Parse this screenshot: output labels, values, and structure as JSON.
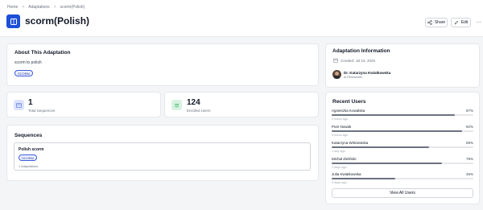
{
  "breadcrumb": {
    "items": [
      "Home",
      "Adaptations",
      "scorm(Polish)"
    ],
    "separator": ">"
  },
  "header": {
    "title": "scorm(Polish)",
    "share_label": "Share",
    "edit_label": "Edit",
    "more_label": "···",
    "icon": "book-icon",
    "accent": "#1d4fd7"
  },
  "about": {
    "heading": "About This Adaptation",
    "description": "scorm to polish",
    "badge": "SCORM"
  },
  "stats": {
    "sequences": {
      "value": "1",
      "label": "Total Sequences",
      "icon": "sequences-icon",
      "icon_bg": "#dbe4fb"
    },
    "users": {
      "value": "124",
      "label": "Enrolled Users",
      "icon": "users-icon",
      "icon_bg": "#d8f3e1"
    }
  },
  "sequences": {
    "heading": "Sequences",
    "items": [
      {
        "title": "Polish scorm",
        "badge": "SCORM",
        "meta": "1 Adaptations"
      }
    ]
  },
  "info": {
    "heading": "Adaptation Information",
    "created": "Created: Jul 16, 2025",
    "author_name": "Dr. Katarzyna Kwiatkowska",
    "author_role": "AI Researcher"
  },
  "recent_users": {
    "heading": "Recent Users",
    "users": [
      {
        "name": "Agnieszka Kowalska",
        "percent_label": "87%",
        "progress": 0.87,
        "time": "2 hours ago"
      },
      {
        "name": "Piotr Nowak",
        "percent_label": "92%",
        "progress": 0.92,
        "time": "5 hours ago"
      },
      {
        "name": "Katarzyna Wiśniewska",
        "percent_label": "69%",
        "progress": 0.69,
        "time": "1 day ago"
      },
      {
        "name": "Michał Zieliński",
        "percent_label": "78%",
        "progress": 0.78,
        "time": "2 days ago"
      },
      {
        "name": "Julia Kwiatkowska",
        "percent_label": "45%",
        "progress": 0.45,
        "time": "3 days ago"
      }
    ],
    "view_all_label": "View All Users"
  }
}
